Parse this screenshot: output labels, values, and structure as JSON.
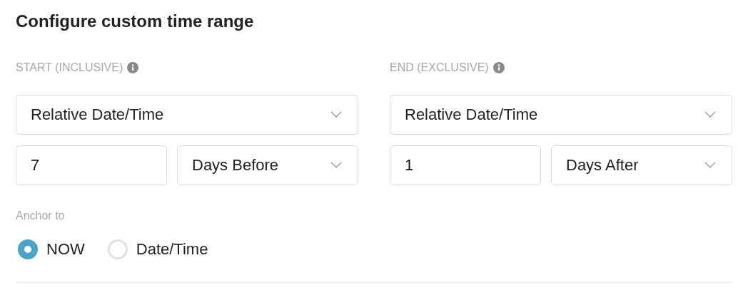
{
  "title": "Configure custom time range",
  "ranges": [
    {
      "label": "START (INCLUSIVE)",
      "mode": "Relative Date/Time",
      "amount": "7",
      "unit": "Days Before"
    },
    {
      "label": "END (EXCLUSIVE)",
      "mode": "Relative Date/Time",
      "amount": "1",
      "unit": "Days After"
    }
  ],
  "anchor": {
    "label": "Anchor to",
    "options": [
      {
        "label": "NOW",
        "selected": true
      },
      {
        "label": "Date/Time",
        "selected": false
      }
    ]
  }
}
